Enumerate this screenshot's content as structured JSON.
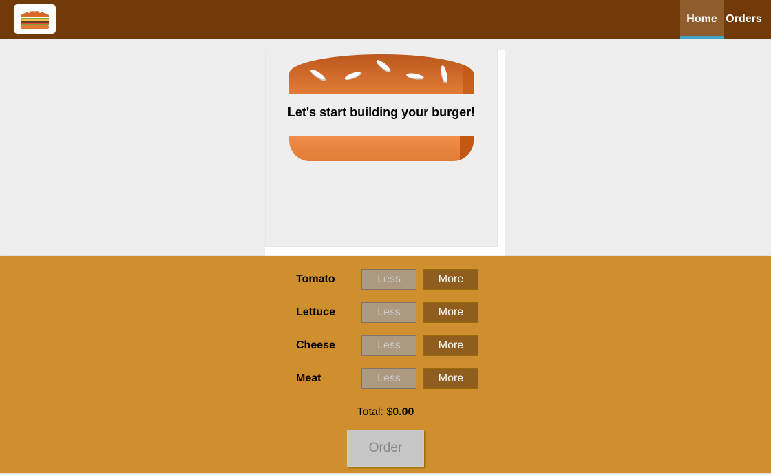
{
  "header": {
    "logo_icon": "burger-logo-icon",
    "nav": [
      {
        "label": "Home",
        "active": true
      },
      {
        "label": "Orders",
        "active": false
      }
    ]
  },
  "preview": {
    "message": "Let's start building your burger!"
  },
  "controls": {
    "ingredients": [
      {
        "label": "Tomato",
        "less": "Less",
        "more": "More"
      },
      {
        "label": "Lettuce",
        "less": "Less",
        "more": "More"
      },
      {
        "label": "Cheese",
        "less": "Less",
        "more": "More"
      },
      {
        "label": "Meat",
        "less": "Less",
        "more": "More"
      }
    ],
    "total_label": "Total: $",
    "total_value": "0.00",
    "order_label": "Order"
  },
  "colors": {
    "header": "#703b09",
    "controls_bg": "#cf8f2e",
    "more_button": "#8f5e1e",
    "less_button": "#ac9980",
    "active_nav_indicator": "#40a4c8"
  }
}
